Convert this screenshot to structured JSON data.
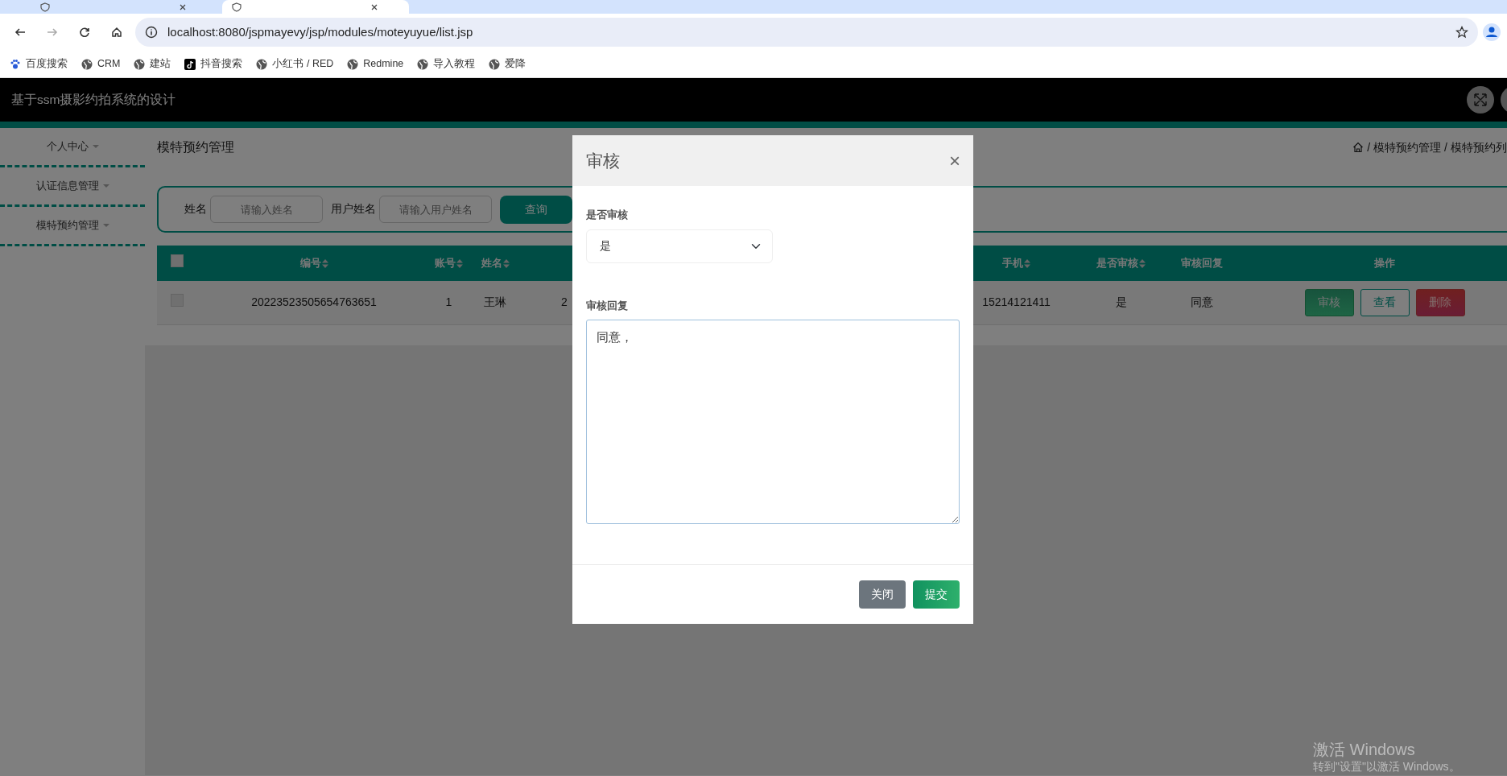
{
  "browser": {
    "tabs": [
      {
        "selected": false
      },
      {
        "selected": true
      }
    ],
    "address": "localhost:8080/jspmayevy/jsp/modules/moteyuyue/list.jsp",
    "bookmarks": [
      {
        "label": "百度搜索",
        "kind": "paw"
      },
      {
        "label": "CRM",
        "kind": "globe"
      },
      {
        "label": "建站",
        "kind": "globe"
      },
      {
        "label": "抖音搜索",
        "kind": "note"
      },
      {
        "label": "小红书 / RED",
        "kind": "globe"
      },
      {
        "label": "Redmine",
        "kind": "globe"
      },
      {
        "label": "导入教程",
        "kind": "globe"
      },
      {
        "label": "爱降",
        "kind": "globe"
      }
    ]
  },
  "app": {
    "title": "基于ssm摄影约拍系统的设计",
    "sidebar": {
      "items": [
        {
          "label": "个人中心"
        },
        {
          "label": "认证信息管理"
        },
        {
          "label": "模特预约管理"
        }
      ]
    },
    "page_title": "模特预约管理",
    "breadcrumb": [
      {
        "label": "模特预约管理",
        "separator": "/"
      },
      {
        "label": "模特预约列",
        "separator": "/"
      }
    ],
    "search": {
      "fields": [
        {
          "label": "姓名",
          "placeholder": "请输入姓名"
        },
        {
          "label": "用户姓名",
          "placeholder": "请输入用户姓名"
        }
      ],
      "button": "查询"
    },
    "table": {
      "select_all": {
        "checked": false
      },
      "columns": [
        {
          "label": "编号",
          "sortable": true
        },
        {
          "label": "账号",
          "sortable": true
        },
        {
          "label": "姓名",
          "sortable": true
        },
        {
          "kind": "hidden"
        },
        {
          "label": "手机",
          "sortable": true
        },
        {
          "label": "是否审核",
          "sortable": true
        },
        {
          "label": "审核回复",
          "sortable": false
        },
        {
          "label": "操作",
          "sortable": false
        }
      ],
      "rows": [
        {
          "checked": false,
          "cells": [
            "20223523505654763651",
            "1",
            "王琳",
            "2",
            "15214121411",
            "是",
            "同意"
          ],
          "actions": [
            {
              "label": "审核",
              "kind": "primary"
            },
            {
              "label": "查看",
              "kind": "outline"
            },
            {
              "label": "删除",
              "kind": "danger"
            }
          ]
        }
      ]
    }
  },
  "modal": {
    "title": "审核",
    "close": "×",
    "fields": [
      {
        "label": "是否审核",
        "kind": "select",
        "value": "是"
      },
      {
        "label": "审核回复",
        "kind": "textarea",
        "value": "同意，"
      }
    ],
    "buttons": [
      {
        "label": "关闭",
        "kind": "secondary"
      },
      {
        "label": "提交",
        "kind": "success"
      }
    ]
  },
  "os_notice": {
    "title": "激活 Windows",
    "subtitle": "转到\"设置\"以激活 Windows。"
  }
}
